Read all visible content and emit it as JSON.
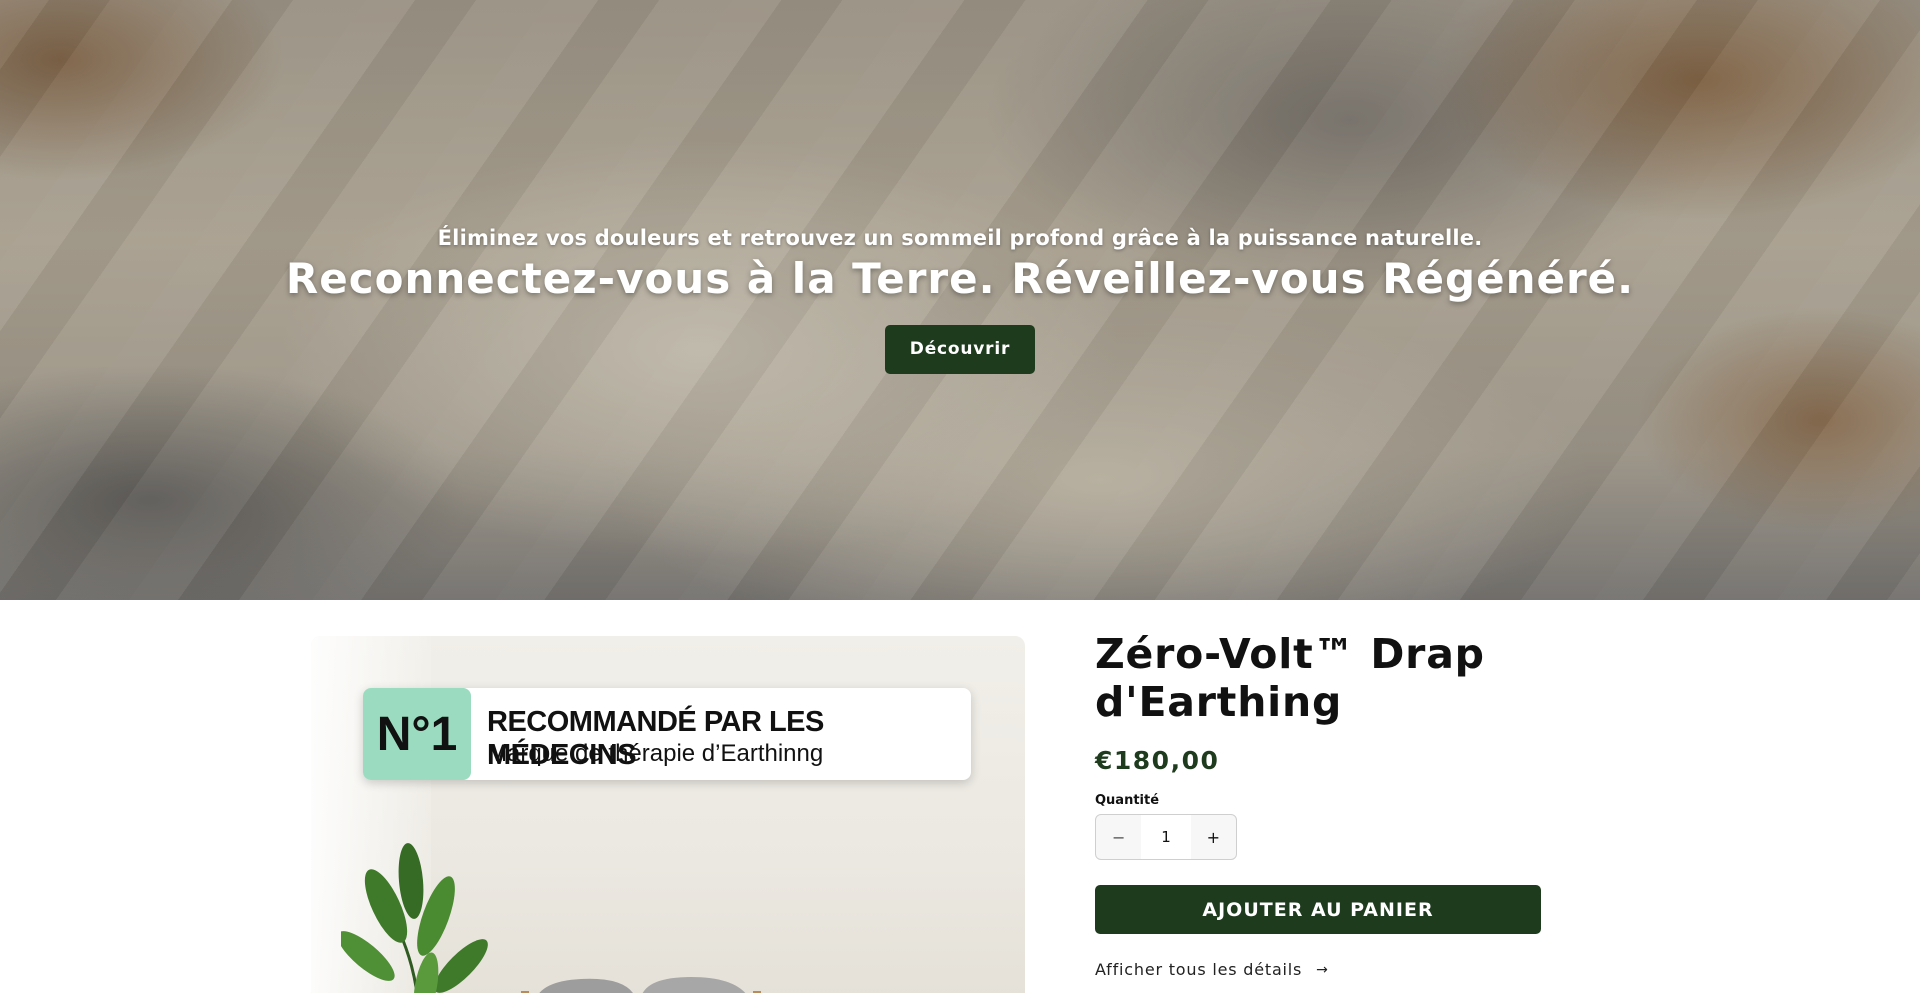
{
  "hero": {
    "subtitle": "Éliminez vos douleurs et retrouvez un sommeil profond grâce à la puissance naturelle.",
    "title": "Reconnectez-vous à la Terre. Réveillez-vous Régénéré.",
    "cta_label": "Découvrir"
  },
  "product": {
    "image_badge": {
      "number": "N°1",
      "line1": "RECOMMANDÉ PAR LES MÉDECINS",
      "line2": "Marque de thérapie d’Earthinng"
    },
    "title": "Zéro-Volt™ Drap d'Earthing",
    "price": "€180,00",
    "quantity_label": "Quantité",
    "quantity_value": "1",
    "minus_glyph": "−",
    "plus_glyph": "+",
    "add_to_cart_label": "AJOUTER AU PANIER",
    "details_link_label": "Afficher tous les détails",
    "details_arrow": "→"
  },
  "colors": {
    "accent_green": "#1f3b1e",
    "badge_mint": "#9bdcc0"
  }
}
